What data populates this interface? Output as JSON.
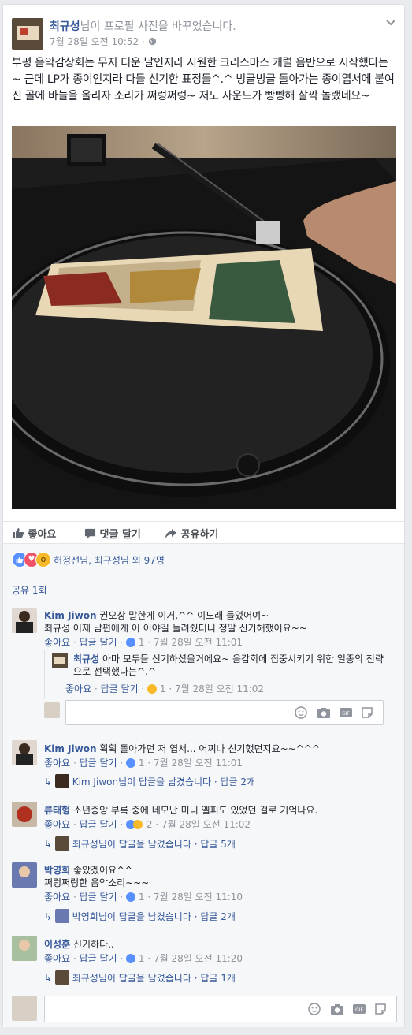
{
  "post": {
    "author": "최규성",
    "action": "님이 프로필 사진을 바꾸었습니다.",
    "timestamp": "7월 28일 오전 10:52 ·",
    "text": "부평 음악감상회는 무지 더운 날인지라 시원한 크리스마스 캐럴 음반으로 시작했다는~ 근데 LP가 종이인지라 다들 신기한 표정들^.^ 빙글빙글 돌아가는 종이엽서에 붙여진 골에 바늘을 올리자 소리가 쩌렁쩌렁~ 저도 사운드가 빵빵해 살짝 놀랬네요~"
  },
  "actions": {
    "like": "좋아요",
    "comment": "댓글 달기",
    "share": "공유하기"
  },
  "reactions": {
    "summary": "허정선님, 최규성님 외 97명"
  },
  "shares": "공유 1회",
  "comments": [
    {
      "author": "Kim Jiwon",
      "text1": "권오상 말한게 이거.^^ 이노래 들었어여~",
      "text2": "최규성 어제 남편에게 이 이야길 들려줬더니 정말 신기해했어요~~",
      "like": "좋아요",
      "reply": "답글 달기",
      "meta": "1 · 7월 28일 오전 11:01"
    },
    {
      "author": "최규성",
      "text": "아마 모두들 신기하셨을거에요~ 음감회에 집중시키기 위한 일종의 전략으로 선택했다는^.^",
      "like": "좋아요",
      "reply": "답글 달기",
      "meta": "1 · 7월 28일 오전 11:02"
    },
    {
      "author": "Kim Jiwon",
      "text": "휙휙 돌아가던 저 엽서... 어찌나 신기했던지요~~^^^",
      "like": "좋아요",
      "reply": "답글 달기",
      "meta": "1 · 7월 28일 오전 11:01",
      "reply_summary_name": "Kim Jiwon",
      "reply_summary_text": "님이 답글을 남겼습니다 · 답글 2개"
    },
    {
      "author": "류태형",
      "text": "소년중앙 부록 중에 네모난 미니 엘피도 있었던 걸로 기억나요.",
      "like": "좋아요",
      "reply": "답글 달기",
      "meta": "2 · 7월 28일 오전 11:02",
      "reply_summary_name": "최규성",
      "reply_summary_text": "님이 답글을 남겼습니다 · 답글 5개"
    },
    {
      "author": "박영희",
      "text1": "좋았겠어요^^",
      "text2": "쩌렁쩌렁한 음악소리~~~",
      "like": "좋아요",
      "reply": "답글 달기",
      "meta": "1 · 7월 28일 오전 11:10",
      "reply_summary_name": "박영희",
      "reply_summary_text": "님이 답글을 남겼습니다 · 답글 2개"
    },
    {
      "author": "이성훈",
      "text": "신기하다..",
      "like": "좋아요",
      "reply": "답글 달기",
      "meta": "1 · 7월 28일 오전 11:20",
      "reply_summary_name": "최규성",
      "reply_summary_text": "님이 답글을 남겼습니다 · 답글 1개"
    }
  ],
  "colors": {
    "link": "#365899",
    "grey": "#90949c",
    "like_blue": "#5890ff",
    "love_red": "#f25268",
    "wow_yellow": "#f7b928"
  }
}
